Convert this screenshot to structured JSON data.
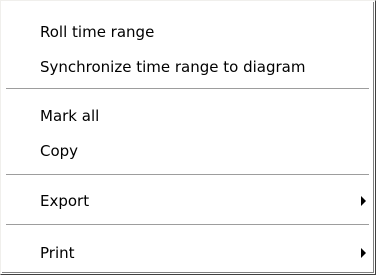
{
  "menu": {
    "items": [
      {
        "label": "Roll time range"
      },
      {
        "label": "Synchronize time range to diagram"
      },
      {
        "label": "Mark all"
      },
      {
        "label": "Copy"
      },
      {
        "label": "Export",
        "icon": "submenu-arrow-icon"
      },
      {
        "label": "Print",
        "icon": "submenu-arrow-icon"
      }
    ]
  }
}
